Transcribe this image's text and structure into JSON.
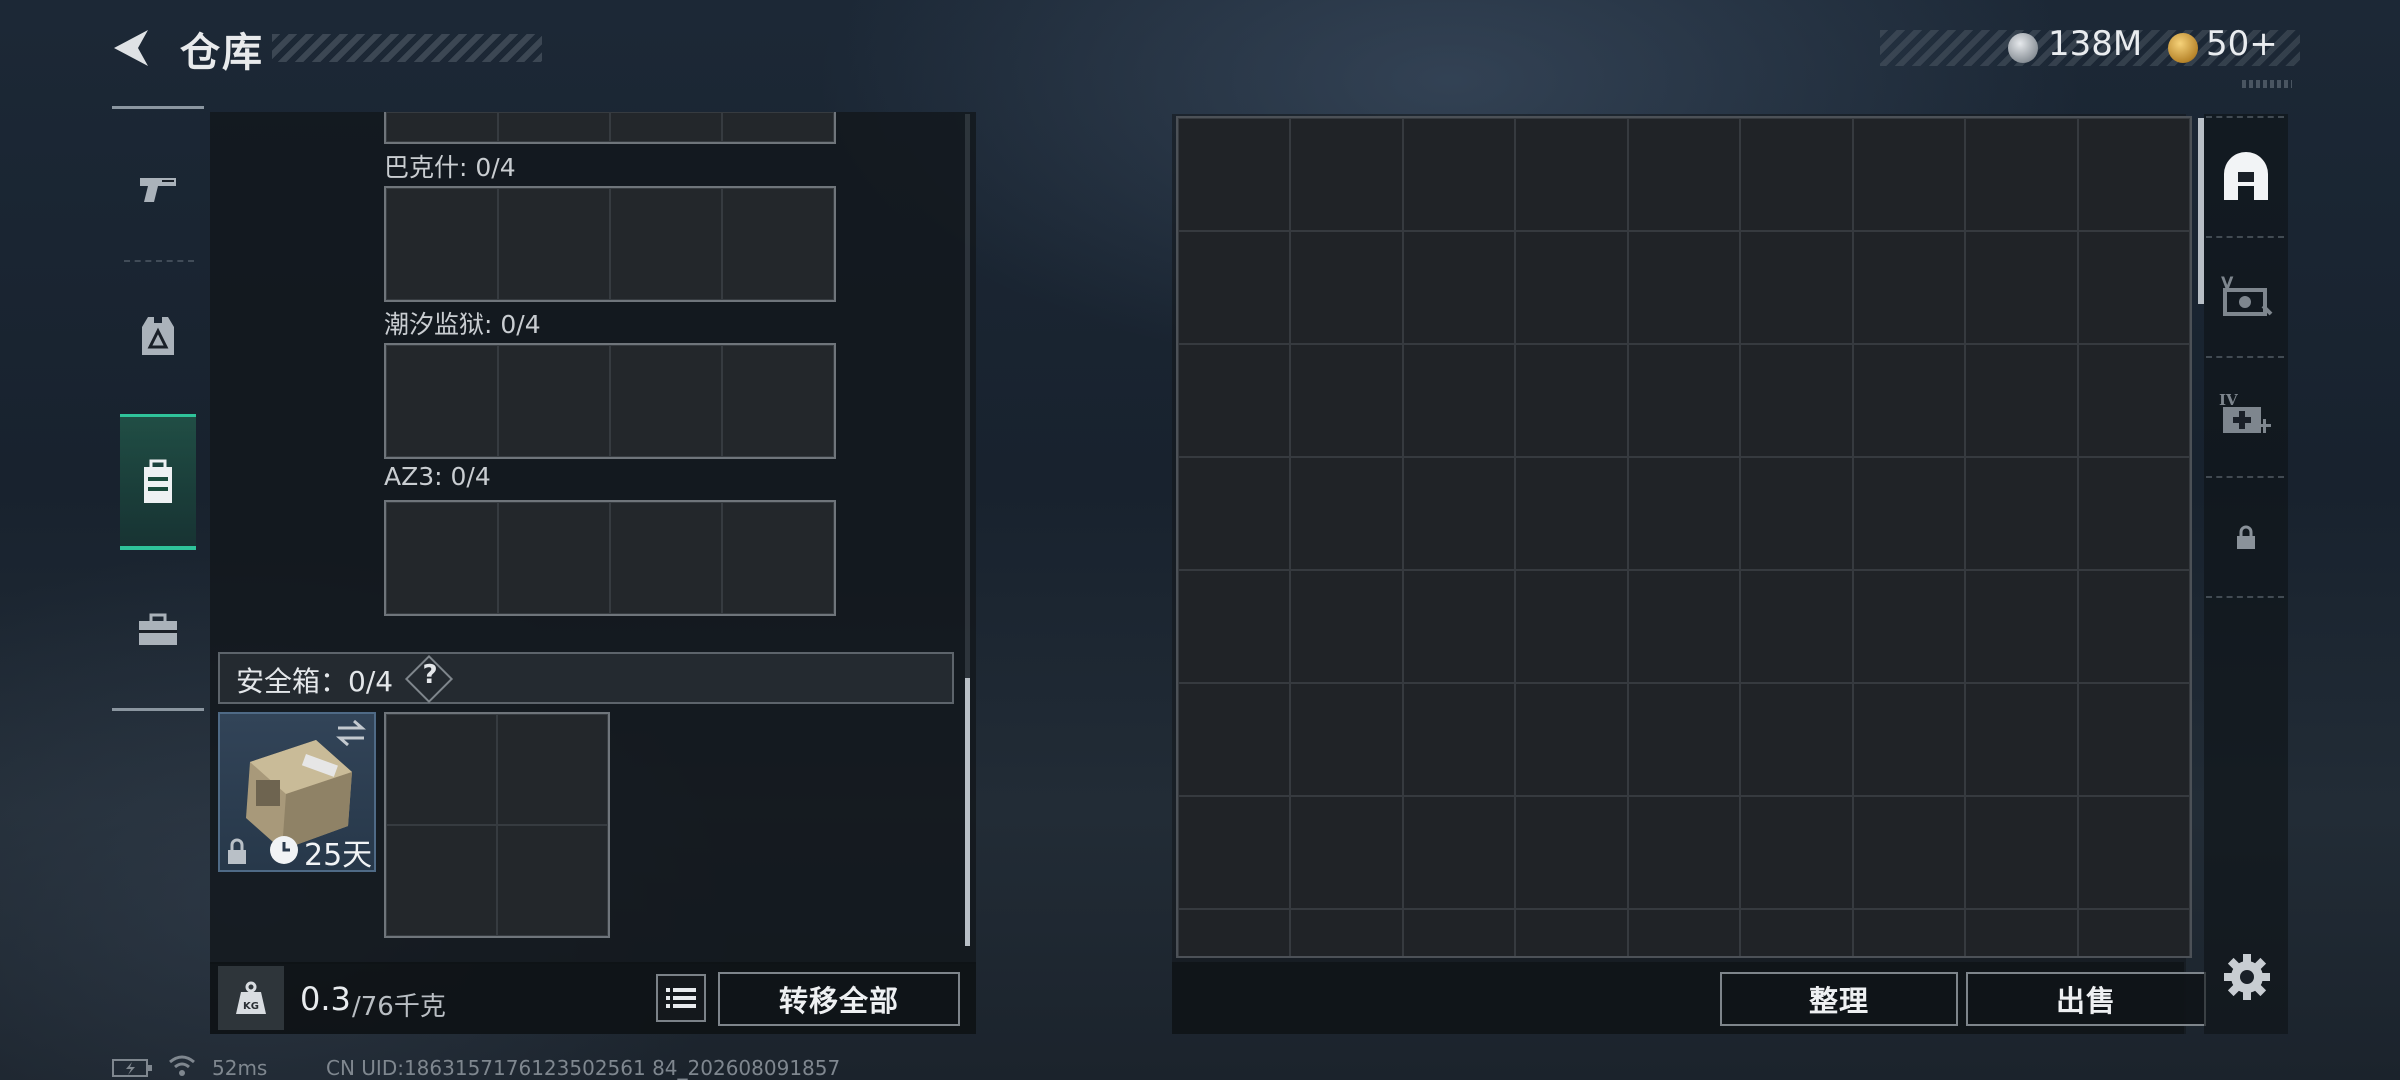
{
  "header": {
    "title": "仓库",
    "currency_silver": "138M",
    "currency_gold": "50+"
  },
  "sidebar": {
    "categories": [
      {
        "icon": "pistol-icon"
      },
      {
        "icon": "armor-vest-icon"
      },
      {
        "icon": "safe-case-icon",
        "active": true
      },
      {
        "icon": "toolbox-icon"
      }
    ]
  },
  "containers": {
    "sections": [
      {
        "label": "巴克什: 0/4"
      },
      {
        "label": "潮汐监狱: 0/4"
      },
      {
        "label": "AZ3: 0/4"
      }
    ],
    "safe_box": {
      "label": "安全箱：0/4",
      "help": "?",
      "duration": "25天"
    }
  },
  "weight": {
    "current": "0.3",
    "max": "/76千克",
    "kg_badge": "KG"
  },
  "actions": {
    "transfer_all": "转移全部",
    "sort": "整理",
    "sell": "出售"
  },
  "right_tabs": [
    {
      "icon": "stash-icon",
      "active": true
    },
    {
      "icon": "v-case-icon"
    },
    {
      "icon": "iv-medkit-icon"
    },
    {
      "icon": "lock-icon"
    }
  ],
  "status": {
    "ping": "52ms",
    "uid": "CN UID:1863157176123502561 84_202608091857"
  },
  "colors": {
    "accent_green": "#2fc39a",
    "panel_dark": "#12171c",
    "text_main": "#e8eaec"
  }
}
